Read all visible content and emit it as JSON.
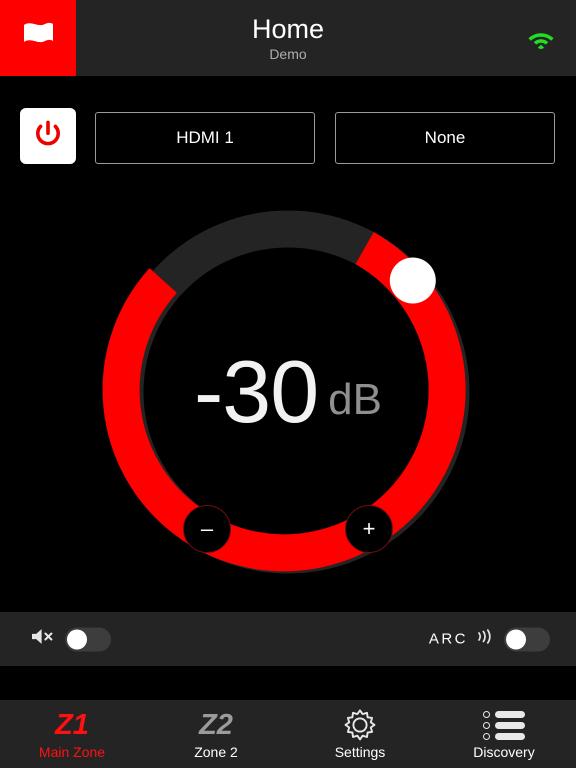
{
  "header": {
    "flag_icon": "flag-icon",
    "title": "Home",
    "subtitle": "Demo",
    "wifi_icon": "wifi-icon",
    "wifi_color": "#22DD22",
    "background": "#242424"
  },
  "source_row": {
    "power_button": {
      "icon": "power-icon",
      "icon_color": "#EE0000",
      "background": "#FFFFFF"
    },
    "inputs": [
      {
        "label": "HDMI 1"
      },
      {
        "label": "None"
      }
    ]
  },
  "volume": {
    "value": "-30",
    "unit": "dB",
    "minus_label": "–",
    "plus_label": "+",
    "arc_color": "#FF0000",
    "track_color": "#242424",
    "knob_color": "#FFFFFF",
    "percent": 62
  },
  "toggles": [
    {
      "name": "mute",
      "icon": "mute-icon",
      "label": "",
      "state": "off"
    },
    {
      "name": "arc",
      "icon": "sound-waves-icon",
      "label": "ARC",
      "state": "off"
    }
  ],
  "tabs": [
    {
      "glyph": "Z1",
      "label": "Main Zone",
      "icon": "zone1-icon",
      "active": true
    },
    {
      "glyph": "Z2",
      "label": "Zone 2",
      "icon": "zone2-icon",
      "active": false
    },
    {
      "glyph": "",
      "label": "Settings",
      "icon": "gear-icon",
      "active": false
    },
    {
      "glyph": "",
      "label": "Discovery",
      "icon": "list-icon",
      "active": false
    }
  ]
}
